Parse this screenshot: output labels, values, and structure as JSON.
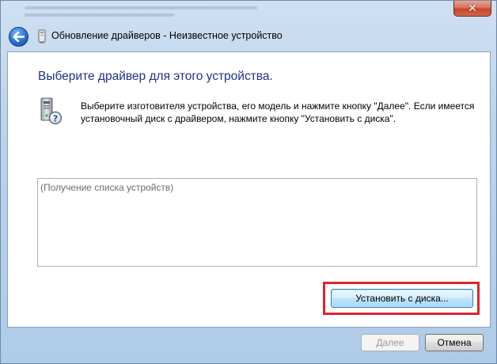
{
  "window": {
    "title": "Обновление драйверов - Неизвестное устройство",
    "close_label": "✕"
  },
  "page": {
    "heading": "Выберите драйвер для этого устройства.",
    "instruction": "Выберите изготовителя устройства, его модель и нажмите кнопку \"Далее\". Если имеется установочный диск с  драйвером, нажмите кнопку \"Установить с диска\".",
    "device_list_status": "(Получение списка устройств)"
  },
  "buttons": {
    "install_from_disk": "Установить с диска...",
    "next": "Далее",
    "cancel": "Отмена"
  },
  "icons": {
    "back": "back-arrow-icon",
    "device_small": "device-icon",
    "hardware_unknown": "unknown-hardware-icon",
    "close": "close-icon"
  },
  "colors": {
    "heading": "#1e3287",
    "highlight": "#e0242a",
    "close_button": "#c4452b"
  }
}
